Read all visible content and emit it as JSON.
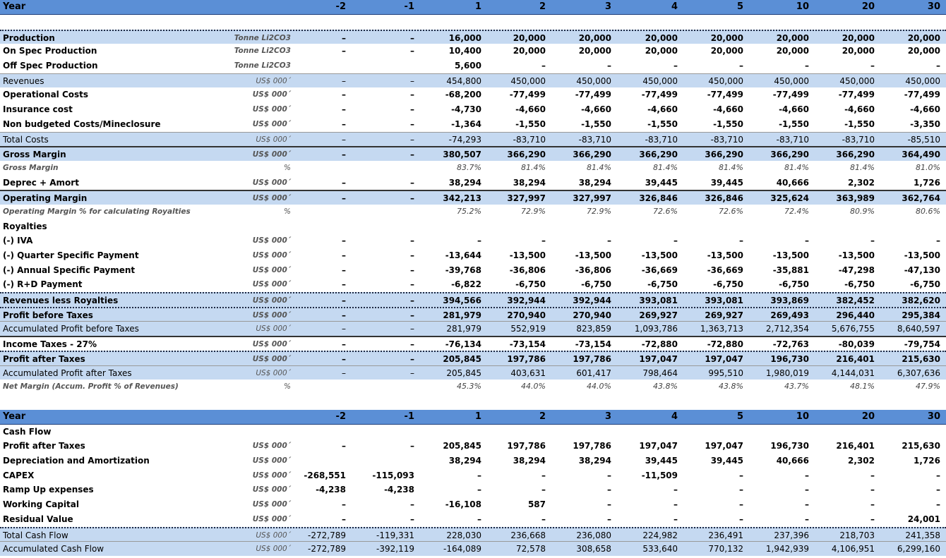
{
  "columns": [
    "-2",
    "-1",
    "1",
    "2",
    "3",
    "4",
    "5",
    "10",
    "20",
    "30"
  ],
  "table1": {
    "header_label": "Year",
    "rows": [
      {
        "label": "Production",
        "unit": "Tonne Li2CO3",
        "values": [
          "–",
          "–",
          "16,000",
          "20,000",
          "20,000",
          "20,000",
          "20,000",
          "20,000",
          "20,000",
          "20,000"
        ],
        "style": "band bold tline"
      },
      {
        "label": "On Spec Production",
        "unit": "Tonne Li2CO3",
        "values": [
          "–",
          "–",
          "10,400",
          "20,000",
          "20,000",
          "20,000",
          "20,000",
          "20,000",
          "20,000",
          "20,000"
        ],
        "style": "bold"
      },
      {
        "label": "Off Spec Production",
        "unit": "Tonne Li2CO3",
        "values": [
          "",
          "",
          "5,600",
          "–",
          "–",
          "–",
          "–",
          "–",
          "–",
          "–"
        ],
        "style": "bold"
      },
      {
        "label": "Revenues",
        "unit": "US$ 000´",
        "values": [
          "–",
          "–",
          "454,800",
          "450,000",
          "450,000",
          "450,000",
          "450,000",
          "450,000",
          "450,000",
          "450,000"
        ],
        "style": "band rule"
      },
      {
        "label": "Operational Costs",
        "unit": "US$ 000´",
        "values": [
          "–",
          "–",
          "-68,200",
          "-77,499",
          "-77,499",
          "-77,499",
          "-77,499",
          "-77,499",
          "-77,499",
          "-77,499"
        ],
        "style": "bold"
      },
      {
        "label": "Insurance cost",
        "unit": "US$ 000´",
        "values": [
          "–",
          "–",
          "-4,730",
          "-4,660",
          "-4,660",
          "-4,660",
          "-4,660",
          "-4,660",
          "-4,660",
          "-4,660"
        ],
        "style": "bold"
      },
      {
        "label": "Non budgeted Costs/Mineclosure",
        "unit": "US$ 000´",
        "values": [
          "–",
          "–",
          "-1,364",
          "-1,550",
          "-1,550",
          "-1,550",
          "-1,550",
          "-1,550",
          "-1,550",
          "-3,350"
        ],
        "style": "bold"
      },
      {
        "label": "Total Costs",
        "unit": "US$ 000´",
        "values": [
          "–",
          "–",
          "-74,293",
          "-83,710",
          "-83,710",
          "-83,710",
          "-83,710",
          "-83,710",
          "-83,710",
          "-85,510"
        ],
        "style": "band rule"
      },
      {
        "label": "Gross Margin",
        "unit": "US$ 000´",
        "values": [
          "–",
          "–",
          "380,507",
          "366,290",
          "366,290",
          "366,290",
          "366,290",
          "366,290",
          "366,290",
          "364,490"
        ],
        "style": "band bold dline"
      },
      {
        "label": "Gross Margin",
        "unit": "%",
        "values": [
          "",
          "",
          "83.7%",
          "81.4%",
          "81.4%",
          "81.4%",
          "81.4%",
          "81.4%",
          "81.4%",
          "81.0%"
        ],
        "style": "ital"
      },
      {
        "label": "Deprec + Amort",
        "unit": "US$ 000´",
        "values": [
          "–",
          "–",
          "38,294",
          "38,294",
          "38,294",
          "39,445",
          "39,445",
          "40,666",
          "2,302",
          "1,726"
        ],
        "style": "bold"
      },
      {
        "label": "Operating Margin",
        "unit": "US$ 000´",
        "values": [
          "–",
          "–",
          "342,213",
          "327,997",
          "327,997",
          "326,846",
          "326,846",
          "325,624",
          "363,989",
          "362,764"
        ],
        "style": "band bold dline"
      },
      {
        "label": "Operating Margin % for calculating Royalties",
        "unit": "%",
        "values": [
          "",
          "",
          "75.2%",
          "72.9%",
          "72.9%",
          "72.6%",
          "72.6%",
          "72.4%",
          "80.9%",
          "80.6%"
        ],
        "style": "ital"
      },
      {
        "label": "Royalties",
        "unit": "",
        "values": [
          "",
          "",
          "",
          "",
          "",
          "",
          "",
          "",
          "",
          ""
        ],
        "style": "bold"
      },
      {
        "label": "(-) IVA",
        "unit": "US$ 000´",
        "values": [
          "–",
          "–",
          "–",
          "–",
          "–",
          "–",
          "–",
          "–",
          "–",
          "–"
        ],
        "style": "bold"
      },
      {
        "label": "(-) Quarter Specific Payment",
        "unit": "US$ 000´",
        "values": [
          "–",
          "–",
          "-13,644",
          "-13,500",
          "-13,500",
          "-13,500",
          "-13,500",
          "-13,500",
          "-13,500",
          "-13,500"
        ],
        "style": "bold"
      },
      {
        "label": "(-) Annual Specific Payment",
        "unit": "US$ 000´",
        "values": [
          "–",
          "–",
          "-39,768",
          "-36,806",
          "-36,806",
          "-36,669",
          "-36,669",
          "-35,881",
          "-47,298",
          "-47,130"
        ],
        "style": "bold"
      },
      {
        "label": "(-) R+D Payment",
        "unit": "US$ 000´",
        "values": [
          "–",
          "–",
          "-6,822",
          "-6,750",
          "-6,750",
          "-6,750",
          "-6,750",
          "-6,750",
          "-6,750",
          "-6,750"
        ],
        "style": "bold"
      },
      {
        "label": "Revenues less Royalties",
        "unit": "US$ 000´",
        "values": [
          "–",
          "–",
          "394,566",
          "392,944",
          "392,944",
          "393,081",
          "393,081",
          "393,869",
          "382,452",
          "382,620"
        ],
        "style": "band bold tline"
      },
      {
        "label": "Profit before Taxes",
        "unit": "US$ 000´",
        "values": [
          "–",
          "–",
          "281,979",
          "270,940",
          "270,940",
          "269,927",
          "269,927",
          "269,493",
          "296,440",
          "295,384"
        ],
        "style": "band bold tline"
      },
      {
        "label": "Accumulated Profit before Taxes",
        "unit": "US$ 000´",
        "values": [
          "–",
          "–",
          "281,979",
          "552,919",
          "823,859",
          "1,093,786",
          "1,363,713",
          "2,712,354",
          "5,676,755",
          "8,640,597"
        ],
        "style": "band plain rule"
      },
      {
        "label": "Income Taxes - 27%",
        "unit": "US$ 000´",
        "values": [
          "–",
          "–",
          "-76,134",
          "-73,154",
          "-73,154",
          "-72,880",
          "-72,880",
          "-72,763",
          "-80,039",
          "-79,754"
        ],
        "style": "bold dline"
      },
      {
        "label": "Profit after Taxes",
        "unit": "US$ 000´",
        "values": [
          "–",
          "–",
          "205,845",
          "197,786",
          "197,786",
          "197,047",
          "197,047",
          "196,730",
          "216,401",
          "215,630"
        ],
        "style": "band bold tline"
      },
      {
        "label": "Accumulated Profit after Taxes",
        "unit": "US$ 000´",
        "values": [
          "–",
          "–",
          "205,845",
          "403,631",
          "601,417",
          "798,464",
          "995,510",
          "1,980,019",
          "4,144,031",
          "6,307,636"
        ],
        "style": "band plain rule"
      },
      {
        "label": "Net Margin (Accum. Profit % of Revenues)",
        "unit": "%",
        "values": [
          "",
          "",
          "45.3%",
          "44.0%",
          "44.0%",
          "43.8%",
          "43.8%",
          "43.7%",
          "48.1%",
          "47.9%"
        ],
        "style": "ital"
      }
    ]
  },
  "table2": {
    "header_label": "Year",
    "rows": [
      {
        "label": "Cash Flow",
        "unit": "",
        "values": [
          "",
          "",
          "",
          "",
          "",
          "",
          "",
          "",
          "",
          ""
        ],
        "style": "bold"
      },
      {
        "label": "Profit after Taxes",
        "unit": "US$ 000´",
        "values": [
          "–",
          "–",
          "205,845",
          "197,786",
          "197,786",
          "197,047",
          "197,047",
          "196,730",
          "216,401",
          "215,630"
        ],
        "style": "bold"
      },
      {
        "label": "Depreciation and Amortization",
        "unit": "US$ 000´",
        "values": [
          "",
          "",
          "38,294",
          "38,294",
          "38,294",
          "39,445",
          "39,445",
          "40,666",
          "2,302",
          "1,726"
        ],
        "style": "bold"
      },
      {
        "label": "CAPEX",
        "unit": "US$ 000´",
        "values": [
          "-268,551",
          "-115,093",
          "–",
          "–",
          "–",
          "-11,509",
          "–",
          "–",
          "–",
          "–"
        ],
        "style": "bold"
      },
      {
        "label": "Ramp Up expenses",
        "unit": "US$ 000´",
        "values": [
          "-4,238",
          "-4,238",
          "–",
          "–",
          "–",
          "–",
          "–",
          "–",
          "–",
          "–"
        ],
        "style": "bold"
      },
      {
        "label": "Working Capital",
        "unit": "US$ 000´",
        "values": [
          "–",
          "–",
          "-16,108",
          "587",
          "–",
          "–",
          "–",
          "–",
          "–",
          "–"
        ],
        "style": "bold"
      },
      {
        "label": "Residual Value",
        "unit": "US$ 000´",
        "values": [
          "–",
          "–",
          "–",
          "–",
          "–",
          "–",
          "–",
          "–",
          "–",
          "24,001"
        ],
        "style": "bold"
      },
      {
        "label": "Total Cash Flow",
        "unit": "US$ 000´",
        "values": [
          "-272,789",
          "-119,331",
          "228,030",
          "236,668",
          "236,080",
          "224,982",
          "236,491",
          "237,396",
          "218,703",
          "241,358"
        ],
        "style": "band tline"
      },
      {
        "label": "Accumulated Cash Flow",
        "unit": "US$ 000´",
        "values": [
          "-272,789",
          "-392,119",
          "-164,089",
          "72,578",
          "308,658",
          "533,640",
          "770,132",
          "1,942,939",
          "4,106,951",
          "6,299,160"
        ],
        "style": "band plain rule"
      }
    ]
  }
}
